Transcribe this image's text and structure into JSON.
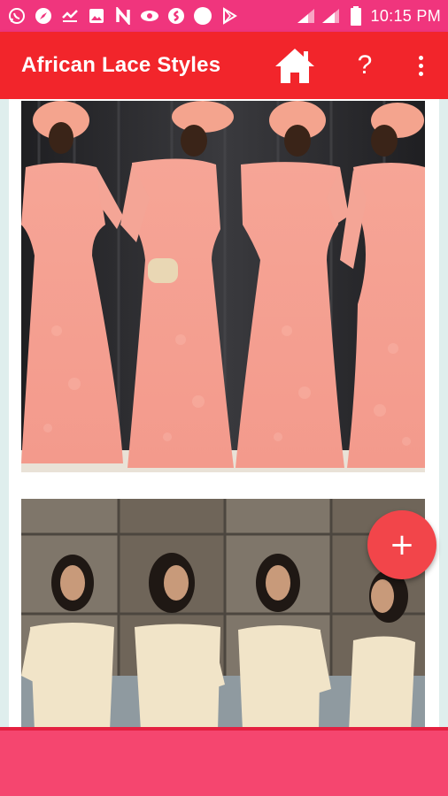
{
  "status_bar": {
    "time": "10:15 PM",
    "notification_icons": [
      "whatsapp-icon",
      "compass-icon",
      "voicemail-icon",
      "image-icon",
      "n-icon",
      "eye-icon",
      "shazam-icon",
      "circle-icon",
      "play-store-icon"
    ],
    "background_color": "#f0357d"
  },
  "app_bar": {
    "title": "African Lace Styles",
    "help_label": "?",
    "background_color": "#f2252b"
  },
  "gallery": {
    "items": [
      "photo-1",
      "photo-2"
    ]
  },
  "fab": {
    "label": "+",
    "color": "#f2454a"
  },
  "bottom_bar": {
    "color": "#f5466f"
  }
}
